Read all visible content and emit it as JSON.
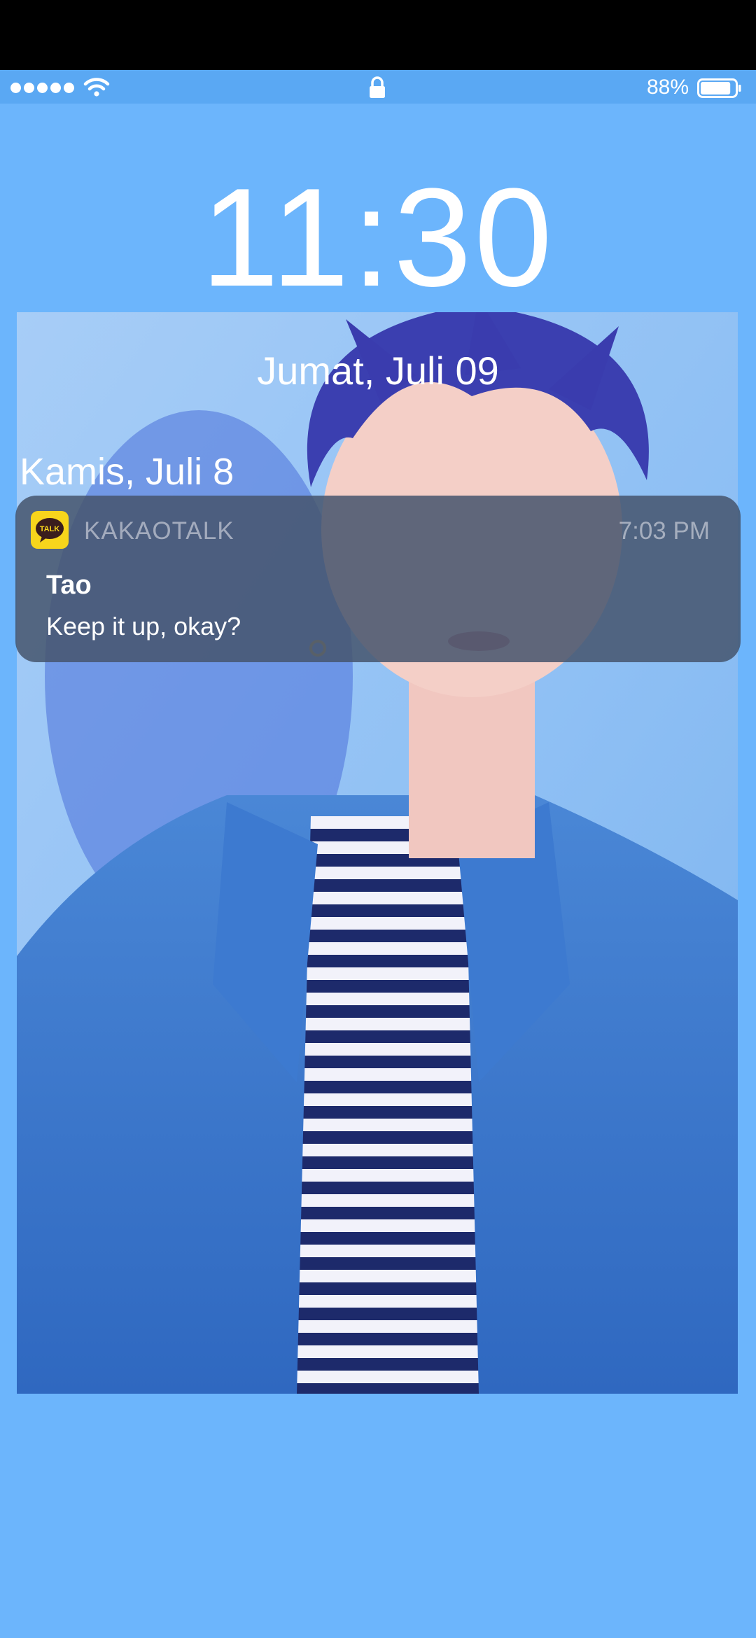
{
  "status_bar": {
    "signal_bars": 5,
    "battery_percent": "88%",
    "battery_level": 0.88
  },
  "lock_screen": {
    "time": "11:30",
    "date": "Jumat, Juli 09"
  },
  "notification_group": {
    "header": "Kamis, Juli 8",
    "notification": {
      "app_name": "KAKAOTALK",
      "app_icon_label": "TALK",
      "time": "7:03 PM",
      "sender": "Tao",
      "message": "Keep it up, okay?"
    }
  },
  "colors": {
    "background": "#6cb5fc",
    "status_bar": "#5aa8f3",
    "kakao_yellow": "#f7d51c"
  },
  "icons": {
    "wifi": "wifi-icon",
    "lock": "lock-icon",
    "battery": "battery-icon",
    "app": "kakaotalk-icon"
  }
}
